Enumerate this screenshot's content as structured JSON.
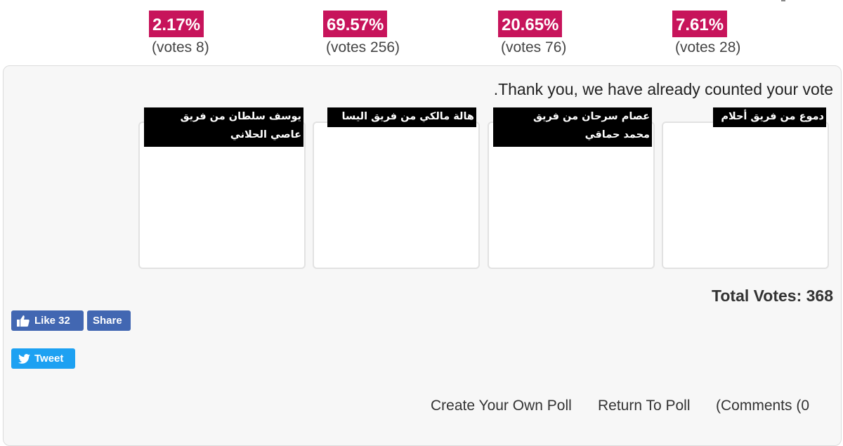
{
  "results": [
    {
      "percent": "2.17%",
      "votes": "(votes 8)"
    },
    {
      "percent": "69.57%",
      "votes": "(votes 256)"
    },
    {
      "percent": "20.65%",
      "votes": "(votes 76)"
    },
    {
      "percent": "7.61%",
      "votes": "(votes 28)"
    }
  ],
  "poll": {
    "thanks": ".Thank you, we have already counted your vote",
    "total_votes": "Total Votes: 368",
    "options": [
      {
        "line1": "يوسف سلطان من فريق",
        "line2": "عاصي الحلاني"
      },
      {
        "line1": "هالة مالكي من فريق اليسا",
        "line2": ""
      },
      {
        "line1": "عصام سرحان من فريق",
        "line2": "محمد حماقي"
      },
      {
        "line1": "دموع من فريق أحلام",
        "line2": ""
      }
    ]
  },
  "social": {
    "like_label": "Like 32",
    "share_label": "Share",
    "tweet_label": "Tweet",
    "facebook_color": "#4267b2",
    "twitter_color": "#1da1f2"
  },
  "links": {
    "create_poll": "Create Your Own Poll",
    "return_poll": "Return To Poll",
    "comments": "(Comments (0"
  },
  "colors": {
    "percent_badge": "#c7145b",
    "option_label_bg": "#000000"
  }
}
